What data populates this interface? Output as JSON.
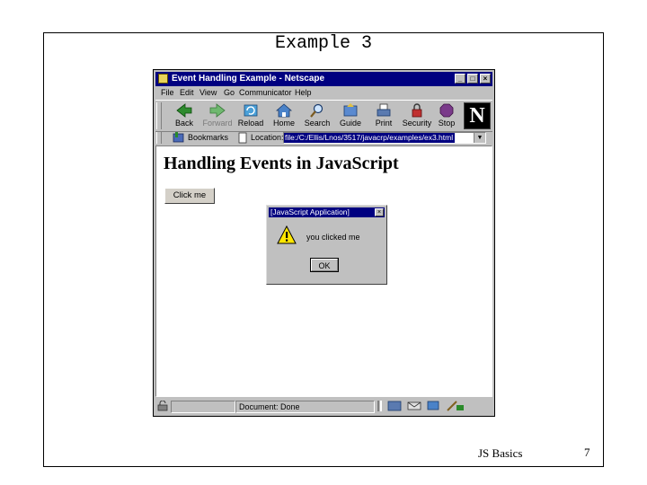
{
  "slide": {
    "title": "Example 3",
    "footer": "JS Basics",
    "page_number": "7"
  },
  "browser": {
    "window_title": "Event Handling Example - Netscape",
    "menu": [
      "File",
      "Edit",
      "View",
      "Go",
      "Communicator",
      "Help"
    ],
    "toolbar": [
      {
        "label": "Back",
        "icon": "back-arrow-icon",
        "enabled": true
      },
      {
        "label": "Forward",
        "icon": "forward-arrow-icon",
        "enabled": false
      },
      {
        "label": "Reload",
        "icon": "reload-icon",
        "enabled": true
      },
      {
        "label": "Home",
        "icon": "home-icon",
        "enabled": true
      },
      {
        "label": "Search",
        "icon": "search-icon",
        "enabled": true
      },
      {
        "label": "Guide",
        "icon": "guide-icon",
        "enabled": true
      },
      {
        "label": "Print",
        "icon": "print-icon",
        "enabled": true
      },
      {
        "label": "Security",
        "icon": "security-lock-icon",
        "enabled": true
      },
      {
        "label": "Stop",
        "icon": "stop-icon",
        "enabled": true
      }
    ],
    "bookmarks_label": "Bookmarks",
    "location_label": "Location:",
    "url": "file:/C:/Ellis/Lnos/3517/javacrp/examples/ex3.html",
    "status": "Document: Done"
  },
  "page": {
    "heading": "Handling Events in JavaScript",
    "button_label": "Click me"
  },
  "alert": {
    "title": "[JavaScript Application]",
    "message": "you clicked me",
    "ok_label": "OK"
  },
  "colors": {
    "titlebar": "#000080",
    "chrome": "#c0c0c0",
    "content_bg": "#ffffff"
  }
}
